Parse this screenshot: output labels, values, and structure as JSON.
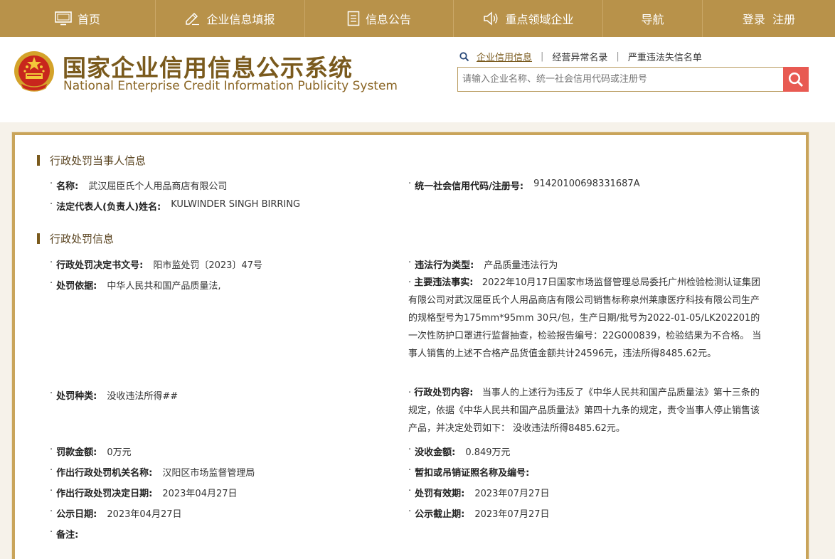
{
  "nav": {
    "items": [
      {
        "label": "首页",
        "icon": "monitor-icon"
      },
      {
        "label": "企业信息填报",
        "icon": "edit-icon"
      },
      {
        "label": "信息公告",
        "icon": "document-icon"
      },
      {
        "label": "重点领域企业",
        "icon": "speaker-icon"
      },
      {
        "label": "导航",
        "icon": ""
      },
      {
        "label": "登录  注册",
        "icon": ""
      }
    ]
  },
  "header": {
    "title_cn": "国家企业信用信息公示系统",
    "title_en": "National Enterprise Credit Information Publicity System",
    "links": [
      "企业信用信息",
      "经营异常名录",
      "严重违法失信名单"
    ],
    "search_placeholder": "请输入企业名称、统一社会信用代码或注册号"
  },
  "party": {
    "section_title": "行政处罚当事人信息",
    "name_label": "名称:",
    "name_value": "武汉屈臣氏个人用品商店有限公司",
    "code_label": "统一社会信用代码/注册号:",
    "code_value": "91420100698331687A",
    "rep_label": "法定代表人(负责人)姓名:",
    "rep_value": "KULWINDER SINGH BIRRING"
  },
  "penalty": {
    "section_title": "行政处罚信息",
    "doc_no_label": "行政处罚决定书文号:",
    "doc_no_value": "阳市监处罚〔2023〕47号",
    "violation_type_label": "违法行为类型:",
    "violation_type_value": "产品质量违法行为",
    "basis_label": "处罚依据:",
    "basis_value": "中华人民共和国产品质量法,",
    "facts_label": "主要违法事实:",
    "facts_value": "2022年10月17日国家市场监督管理总局委托广州检验检测认证集团有限公司对武汉屈臣氏个人用品商店有限公司销售标称泉州莱康医疗科技有限公司生产的规格型号为175mm*95mm 30只/包，生产日期/批号为2022-01-05/LK202201的一次性防护口罩进行监督抽查，检验报告编号：22G000839，检验结果为不合格。 当事人销售的上述不合格产品货值金额共计24596元，违法所得8485.62元。",
    "kind_label": "处罚种类:",
    "kind_value": "没收违法所得##",
    "content_label": "行政处罚内容:",
    "content_value": "当事人的上述行为违反了《中华人民共和国产品质量法》第十三条的规定，依据《中华人民共和国产品质量法》第四十九条的规定，责令当事人停止销售该产品，并决定处罚如下： 没收违法所得8485.62元。",
    "fine_label": "罚款金额:",
    "fine_value": "0万元",
    "confiscate_label": "没收金额:",
    "confiscate_value": "0.849万元",
    "authority_label": "作出行政处罚机关名称:",
    "authority_value": "汉阳区市场监督管理局",
    "license_label": "暂扣或吊销证照名称及编号:",
    "license_value": "",
    "decision_date_label": "作出行政处罚决定日期:",
    "decision_date_value": "2023年04月27日",
    "valid_label": "处罚有效期:",
    "valid_value": "2023年07月27日",
    "publish_date_label": "公示日期:",
    "publish_date_value": "2023年04月27日",
    "publish_end_label": "公示截止期:",
    "publish_end_value": "2023年07月27日",
    "remark_label": "备注:",
    "remark_value": ""
  }
}
